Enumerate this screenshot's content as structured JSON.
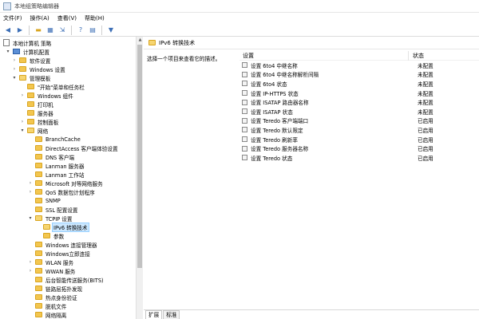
{
  "window": {
    "title": "本地组策略编辑器"
  },
  "menu": [
    "文件(F)",
    "操作(A)",
    "查看(V)",
    "帮助(H)"
  ],
  "toolbar": [
    "back-icon",
    "forward-icon",
    "folder-icon",
    "console-tree-icon",
    "export-icon",
    "help-icon",
    "properties-icon",
    "filter-icon"
  ],
  "tree": {
    "root": "本地计算机 策略",
    "items": [
      {
        "label": "计算机配置",
        "twisty": "▾",
        "icon": "pc"
      },
      {
        "label": "软件设置",
        "twisty": "›",
        "icon": "folder"
      },
      {
        "label": "Windows 设置",
        "twisty": "›",
        "icon": "folder"
      },
      {
        "label": "管理模板",
        "twisty": "▾",
        "icon": "folder-open"
      },
      {
        "label": "\"开始\"菜单和任务栏",
        "twisty": "",
        "icon": "folder"
      },
      {
        "label": "Windows 组件",
        "twisty": "›",
        "icon": "folder"
      },
      {
        "label": "打印机",
        "twisty": "",
        "icon": "folder"
      },
      {
        "label": "服务器",
        "twisty": "",
        "icon": "folder"
      },
      {
        "label": "控制面板",
        "twisty": "›",
        "icon": "folder"
      },
      {
        "label": "网络",
        "twisty": "▾",
        "icon": "folder-open"
      },
      {
        "label": "BranchCache",
        "twisty": "",
        "icon": "folder"
      },
      {
        "label": "DirectAccess 客户端体验设置",
        "twisty": "",
        "icon": "folder"
      },
      {
        "label": "DNS 客户端",
        "twisty": "",
        "icon": "folder"
      },
      {
        "label": "Lanman 服务器",
        "twisty": "",
        "icon": "folder"
      },
      {
        "label": "Lanman 工作站",
        "twisty": "",
        "icon": "folder"
      },
      {
        "label": "Microsoft 对等网络服务",
        "twisty": "›",
        "icon": "folder"
      },
      {
        "label": "QoS 数据包计划程序",
        "twisty": "›",
        "icon": "folder"
      },
      {
        "label": "SNMP",
        "twisty": "",
        "icon": "folder"
      },
      {
        "label": "SSL 配置设置",
        "twisty": "",
        "icon": "folder"
      },
      {
        "label": "TCPIP 设置",
        "twisty": "▾",
        "icon": "folder-open"
      },
      {
        "label": "IPv6 转换技术",
        "twisty": "",
        "icon": "folder-open"
      },
      {
        "label": "参数",
        "twisty": "",
        "icon": "folder"
      },
      {
        "label": "Windows 连接管理器",
        "twisty": "",
        "icon": "folder"
      },
      {
        "label": "Windows立即连接",
        "twisty": "",
        "icon": "folder"
      },
      {
        "label": "WLAN 服务",
        "twisty": "›",
        "icon": "folder"
      },
      {
        "label": "WWAN 服务",
        "twisty": "›",
        "icon": "folder"
      },
      {
        "label": "后台智能传送服务(BITS)",
        "twisty": "",
        "icon": "folder"
      },
      {
        "label": "链路层拓扑发现",
        "twisty": "",
        "icon": "folder"
      },
      {
        "label": "热点身份验证",
        "twisty": "",
        "icon": "folder"
      },
      {
        "label": "脱机文件",
        "twisty": "",
        "icon": "folder"
      },
      {
        "label": "网络隔离",
        "twisty": "",
        "icon": "folder"
      }
    ]
  },
  "detail": {
    "folder_title": "IPv6 转换技术",
    "description": "选择一个项目来查看它的描述。",
    "col_setting": "设置",
    "col_state": "状态",
    "rows": [
      {
        "name": "设置 6to4 中继名称",
        "state": "未配置"
      },
      {
        "name": "设置 6to4 中继名称解析间隔",
        "state": "未配置"
      },
      {
        "name": "设置 6to4 状态",
        "state": "未配置"
      },
      {
        "name": "设置 IP-HTTPS 状态",
        "state": "未配置"
      },
      {
        "name": "设置 ISATAP 路由器名称",
        "state": "未配置"
      },
      {
        "name": "设置 ISATAP 状态",
        "state": "未配置"
      },
      {
        "name": "设置 Teredo 客户端端口",
        "state": "已启用"
      },
      {
        "name": "设置 Teredo 默认限定",
        "state": "已启用"
      },
      {
        "name": "设置 Teredo 刷新率",
        "state": "已启用"
      },
      {
        "name": "设置 Teredo 服务器名称",
        "state": "已启用"
      },
      {
        "name": "设置 Teredo 状态",
        "state": "已启用"
      }
    ],
    "tabs": [
      "扩展",
      "标准"
    ]
  }
}
